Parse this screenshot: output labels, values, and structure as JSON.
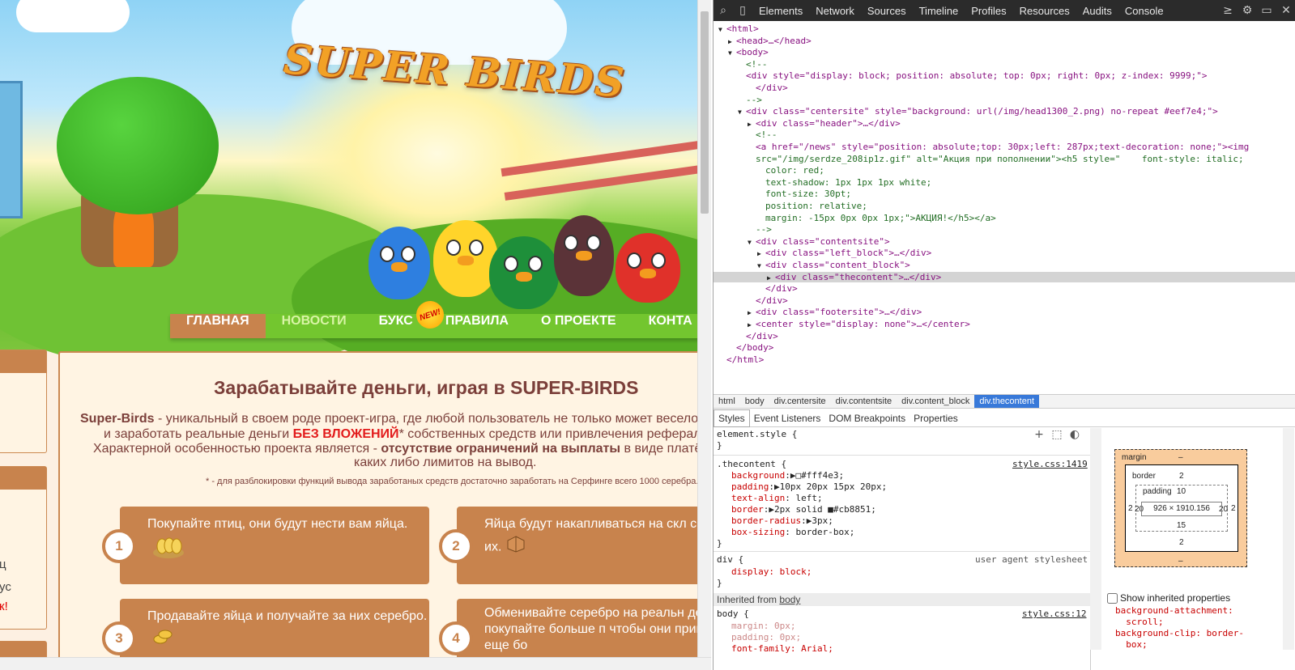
{
  "site": {
    "logo_text": "SUPER BIRDS",
    "nav": [
      {
        "label": "ГЛАВНАЯ"
      },
      {
        "label": "НОВОСТИ"
      },
      {
        "label": "БУКС"
      },
      {
        "label": "ПРАВИЛА"
      },
      {
        "label": "О ПРОЕКТЕ"
      },
      {
        "label": "КОНТА"
      }
    ],
    "new_badge": "NEW!",
    "left_fragments": [
      "ц",
      "ус",
      "к!"
    ],
    "content": {
      "title": "Зарабатывайте деньги, играя в SUPER-BIRDS",
      "p1_bold": "Super-Birds",
      "p1_rest": " - уникальный в своем роде проект-игра, где любой пользователь не только может весело п",
      "p2_start": "и заработать реальные деньги ",
      "p2_red": "БЕЗ ВЛОЖЕНИЙ",
      "p2_rest": "* собственных средств или привлечения рефералов",
      "p3_start": "Характерной особенностью проекта является - ",
      "p3_bold": "отсутствие ограничений на выплаты",
      "p3_rest": " в виде платёж",
      "p4": "каких либо лимитов на вывод.",
      "note": "* - для разблокировки функций вывода заработаных средств достаточно заработать на Серфинге всего 1000 серебра."
    },
    "cards": [
      {
        "num": "1",
        "text": "Покупайте птиц, они будут нести вам яйца."
      },
      {
        "num": "2",
        "text": "Яйца будут накапливаться на скл собирайте их."
      },
      {
        "num": "3",
        "text": "Продавайте яйца и получайте за них серебро."
      },
      {
        "num": "4",
        "text": "Обменивайте серебро на реальн деньги, либо покупайте больше п чтобы они приносили вам еще бо"
      }
    ]
  },
  "devtools": {
    "tabs": [
      "Elements",
      "Network",
      "Sources",
      "Timeline",
      "Profiles",
      "Resources",
      "Audits",
      "Console"
    ],
    "dom_lines": [
      {
        "indent": 0,
        "tri": "▼",
        "text": "<html>"
      },
      {
        "indent": 1,
        "tri": "▶",
        "text": "<head>…</head>"
      },
      {
        "indent": 1,
        "tri": "▼",
        "text": "<body>"
      },
      {
        "indent": 2,
        "tri": "",
        "text": "<!--"
      },
      {
        "indent": 2,
        "tri": "",
        "text": "<div style=\"display: block; position: absolute; top: 0px; right: 0px; z-index: 9999;\">"
      },
      {
        "indent": 3,
        "tri": "",
        "text": "</div>"
      },
      {
        "indent": 2,
        "tri": "",
        "text": "-->"
      },
      {
        "indent": 2,
        "tri": "▼",
        "text": "<div class=\"centersite\" style=\"background: url(/img/head1300_2.png) no-repeat #eef7e4;\">"
      },
      {
        "indent": 3,
        "tri": "▶",
        "text": "<div class=\"header\">…</div>"
      },
      {
        "indent": 3,
        "tri": "",
        "text": "<!--"
      },
      {
        "indent": 3,
        "tri": "",
        "text": "<a href=\"/news\" style=\"position: absolute;top: 30px;left: 287px;text-decoration: none;\"><img"
      },
      {
        "indent": 3,
        "tri": "",
        "text": "src=\"/img/serdze_208ip1z.gif\" alt=\"Акция при пополнении\"><h5 style=\"    font-style: italic;"
      },
      {
        "indent": 4,
        "tri": "",
        "text": "color: red;"
      },
      {
        "indent": 4,
        "tri": "",
        "text": "text-shadow: 1px 1px 1px white;"
      },
      {
        "indent": 4,
        "tri": "",
        "text": "font-size: 30pt;"
      },
      {
        "indent": 4,
        "tri": "",
        "text": "position: relative;"
      },
      {
        "indent": 4,
        "tri": "",
        "text": "margin: -15px 0px 0px 1px;\">АКЦИЯ!</h5></a>"
      },
      {
        "indent": 3,
        "tri": "",
        "text": "-->"
      },
      {
        "indent": 3,
        "tri": "▼",
        "text": "<div class=\"contentsite\">"
      },
      {
        "indent": 4,
        "tri": "▶",
        "text": "<div class=\"left_block\">…</div>"
      },
      {
        "indent": 4,
        "tri": "▼",
        "text": "<div class=\"content_block\">"
      },
      {
        "indent": 5,
        "tri": "▶",
        "text": "<div class=\"thecontent\">…</div>"
      },
      {
        "indent": 4,
        "tri": "",
        "text": "</div>"
      },
      {
        "indent": 3,
        "tri": "",
        "text": "</div>"
      },
      {
        "indent": 3,
        "tri": "▶",
        "text": "<div class=\"footersite\">…</div>"
      },
      {
        "indent": 3,
        "tri": "▶",
        "text": "<center style=\"display: none\">…</center>"
      },
      {
        "indent": 2,
        "tri": "",
        "text": "</div>"
      },
      {
        "indent": 1,
        "tri": "",
        "text": "</body>"
      },
      {
        "indent": 0,
        "tri": "",
        "text": "</html>"
      }
    ],
    "breadcrumbs": [
      "html",
      "body",
      "div.centersite",
      "div.contentsite",
      "div.content_block",
      "div.thecontent"
    ],
    "subtabs": [
      "Styles",
      "Event Listeners",
      "DOM Breakpoints",
      "Properties"
    ],
    "styles": {
      "element_style": "element.style {",
      "close": "}",
      "rule1_selector": ".thecontent {",
      "rule1_source": "style.css:1419",
      "rule1_props": [
        {
          "name": "background",
          "value": "#fff4e3;"
        },
        {
          "name": "padding",
          "value": "10px 20px 15px 20px;"
        },
        {
          "name": "text-align",
          "value": "left;"
        },
        {
          "name": "border",
          "value": "2px solid ■#cb8851;"
        },
        {
          "name": "border-radius",
          "value": "3px;"
        },
        {
          "name": "box-sizing",
          "value": "border-box;"
        }
      ],
      "rule2_selector": "div {",
      "rule2_source": "user agent stylesheet",
      "rule2_prop": "display: block;",
      "inherited_label": "Inherited from",
      "inherited_from": "body",
      "rule3_selector": "body {",
      "rule3_source": "style.css:12",
      "rule3_props": [
        "margin: 0px;",
        "padding: 0px;",
        "font-family: Arial;"
      ]
    },
    "boxmodel": {
      "margin_label": "margin",
      "margin_value": "–",
      "border_label": "border",
      "border_value": "2",
      "padding_label": "padding",
      "padding_value": "10",
      "size": "926 × 1910.156",
      "pad_left": "20",
      "pad_right": "20",
      "pad_bottom": "15",
      "border_left": "2",
      "border_right": "2",
      "border_bottom": "2",
      "margin_bottom": "–"
    },
    "show_inherited": "Show inherited properties",
    "computed": "background-attachment:\n  scroll;\nbackground-clip: border-\n  box;"
  }
}
